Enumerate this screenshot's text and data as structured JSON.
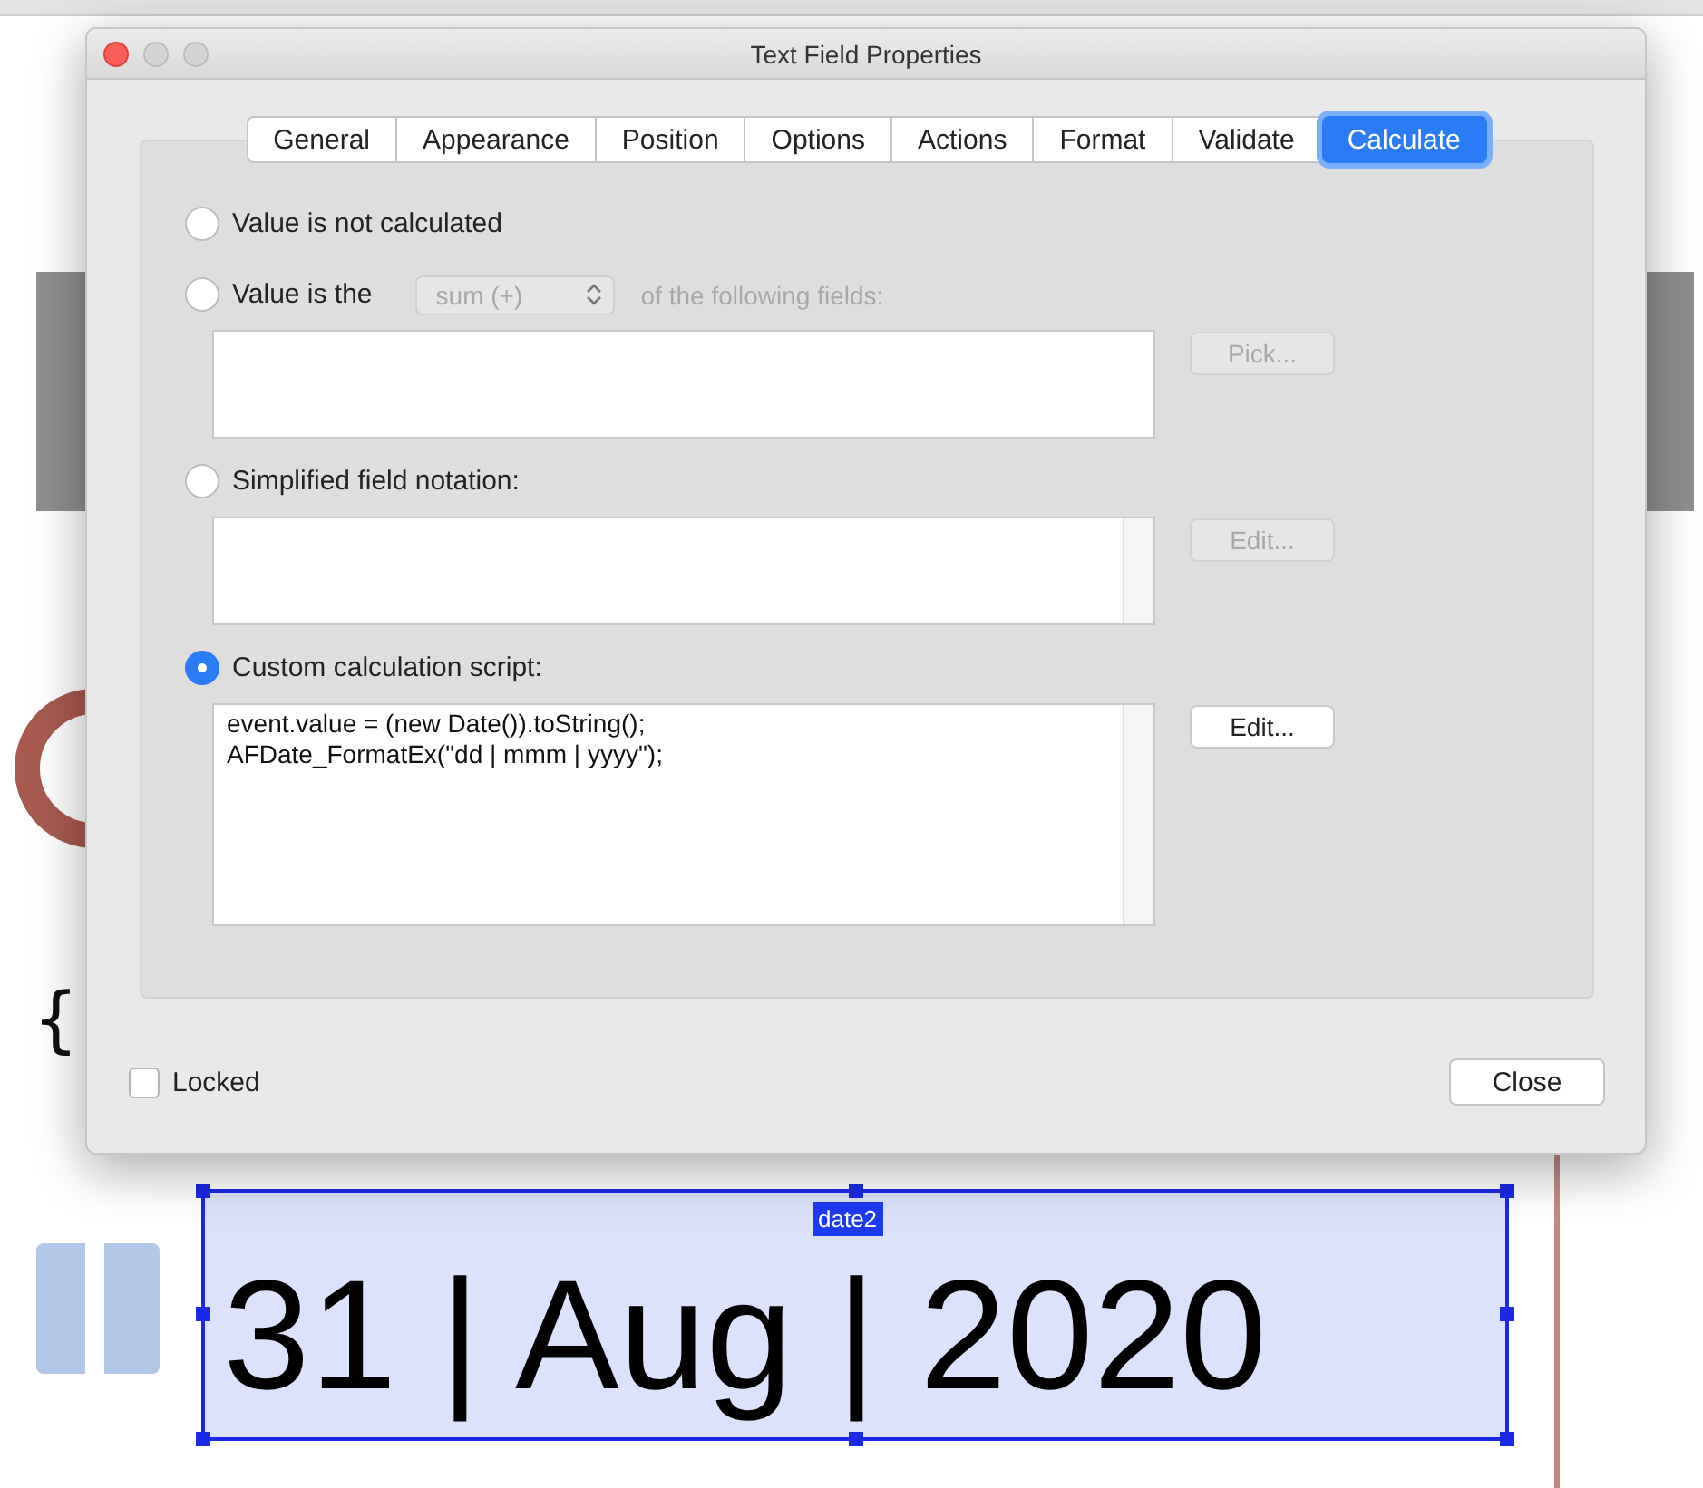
{
  "window": {
    "title": "Text Field Properties"
  },
  "tabs": [
    {
      "label": "General",
      "selected": false
    },
    {
      "label": "Appearance",
      "selected": false
    },
    {
      "label": "Position",
      "selected": false
    },
    {
      "label": "Options",
      "selected": false
    },
    {
      "label": "Actions",
      "selected": false
    },
    {
      "label": "Format",
      "selected": false
    },
    {
      "label": "Validate",
      "selected": false
    },
    {
      "label": "Calculate",
      "selected": true
    }
  ],
  "calculation_options": [
    {
      "kind": "none",
      "label": "Value is not calculated",
      "selected": false
    },
    {
      "kind": "fields",
      "label": "Value is the",
      "selected": false,
      "dropdown": "sum (+)",
      "suffix": "of the following fields:",
      "button": {
        "label": "Pick...",
        "disabled": true
      }
    },
    {
      "kind": "simplified",
      "label": "Simplified field notation:",
      "selected": false,
      "button": {
        "label": "Edit...",
        "disabled": true
      }
    },
    {
      "kind": "script",
      "label": "Custom calculation script:",
      "selected": true,
      "script": "event.value = (new Date()).toString();\nAFDate_FormatEx(\"dd | mmm | yyyy\");",
      "button": {
        "label": "Edit...",
        "disabled": false
      }
    }
  ],
  "locked": {
    "label": "Locked",
    "checked": false
  },
  "close_button": "Close",
  "document": {
    "fragment": "{",
    "field": {
      "value": "31 | Aug | 2020",
      "name": "date2"
    }
  }
}
